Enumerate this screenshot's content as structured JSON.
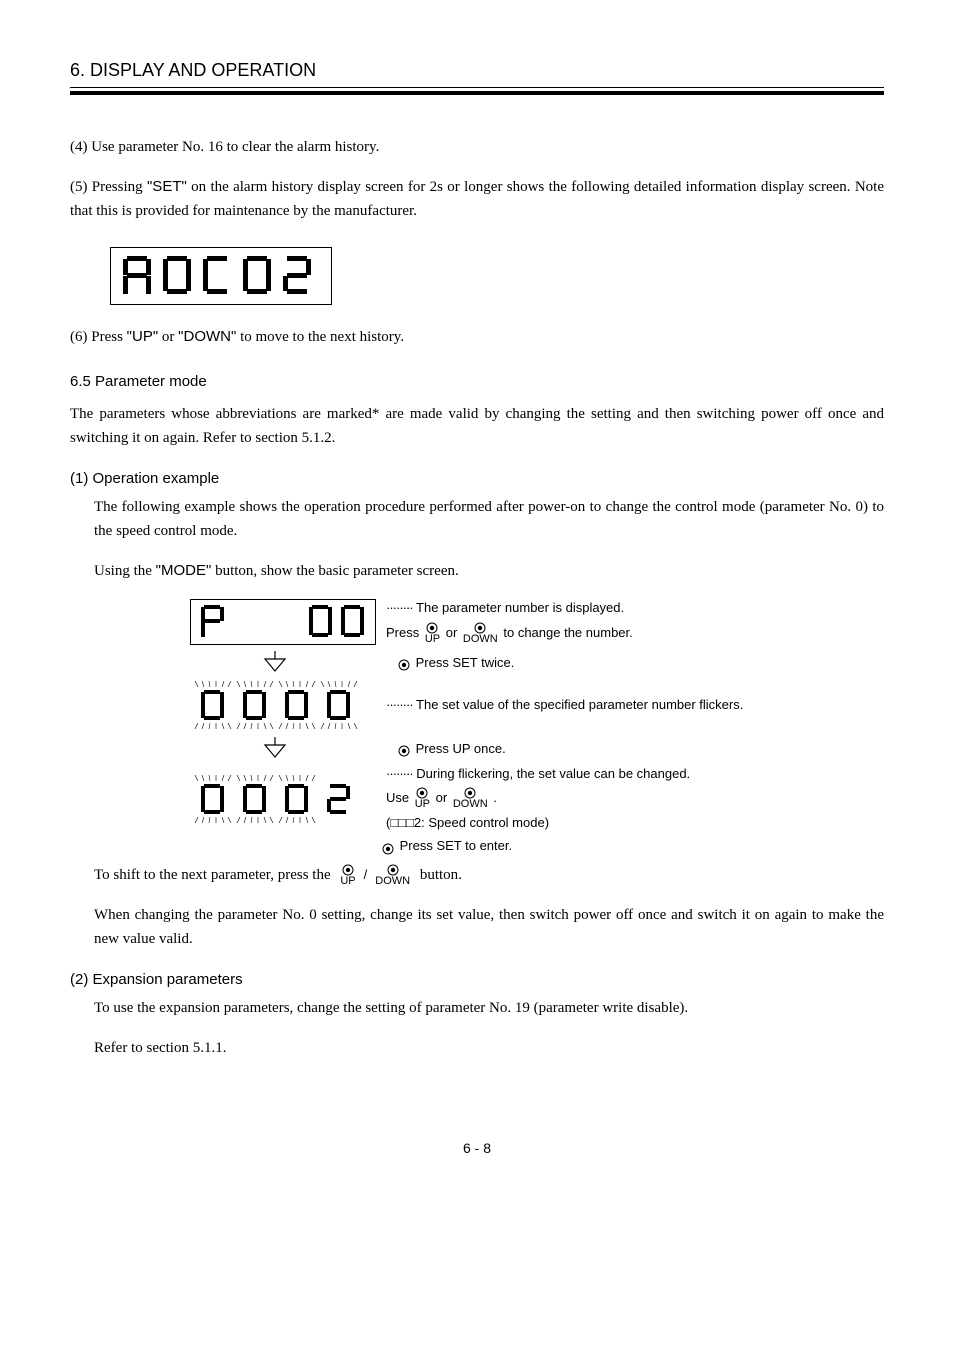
{
  "header": {
    "title": "6. DISPLAY AND OPERATION"
  },
  "body": {
    "p4": "(4) Use parameter No. 16 to clear the alarm history.",
    "p5_a": "(5) Pressing ",
    "p5_set": "\"SET\"",
    "p5_b": " on the alarm history display screen for 2s or longer shows the following detailed information display screen. Note that this is provided for maintenance by the manufacturer.",
    "p6_a": "(6) Press ",
    "p6_up": "\"UP\"",
    "p6_or": " or ",
    "p6_down": "\"DOWN\"",
    "p6_b": " to move to the next history.",
    "sec65": "6.5 Parameter mode",
    "sec65_p": "The parameters whose abbreviations are marked* are made valid by changing the setting and then switching power off once and switching it on again. Refer to section 5.1.2.",
    "sub1": "(1) Operation example",
    "sub1_p1": "The following example shows the operation procedure performed after power-on to change the control mode (parameter No. 0) to the speed control mode.",
    "sub1_p2a": "Using the ",
    "sub1_mode": "\"MODE\"",
    "sub1_p2b": " button, show the basic parameter screen.",
    "shift_a": "To shift to the next parameter, press the ",
    "shift_b": " button.",
    "sub1_p3": "When changing the parameter No. 0 setting, change its set value, then switch power off once and switch it on again to make the new value valid.",
    "sub2": "(2) Expansion parameters",
    "sub2_p1": "To use the expansion parameters, change the setting of parameter No. 19 (parameter write disable).",
    "sub2_p2": "Refer to section 5.1.1."
  },
  "flow": {
    "r1a": "The parameter number is displayed.",
    "r1b_a": "Press ",
    "r1b_b": " or ",
    "r1b_c": " to change the number.",
    "up": "UP",
    "down": "DOWN",
    "set": "SET",
    "press_set_twice": "Press SET twice.",
    "r2": "The set value of the specified parameter number flickers.",
    "press_up_once": "Press UP once.",
    "r3a": "During flickering, the set value can be changed.",
    "r3b_a": "Use ",
    "r3b_b": " or ",
    "r3b_c": " .",
    "r3c": "(□□□2: Speed control mode)",
    "press_set_enter": "Press SET to enter."
  },
  "footer": {
    "page": "6 - 8"
  },
  "chart_data": {
    "type": "table",
    "title": "Parameter mode operation flow — 7-segment display states",
    "steps": [
      {
        "display": "P   00",
        "note": "Parameter number shown; UP/DOWN changes number"
      },
      {
        "action": "Press SET twice"
      },
      {
        "display": "0000",
        "state": "all digits flickering",
        "note": "Set value of specified parameter number flickers"
      },
      {
        "action": "Press UP once"
      },
      {
        "display": "0002",
        "state": "first three digits flickering",
        "note": "During flickering, set value can be changed via UP/DOWN. □□□2 = Speed control mode"
      },
      {
        "action": "Press SET to enter"
      }
    ],
    "alarm_detail_display": "A0C02"
  }
}
